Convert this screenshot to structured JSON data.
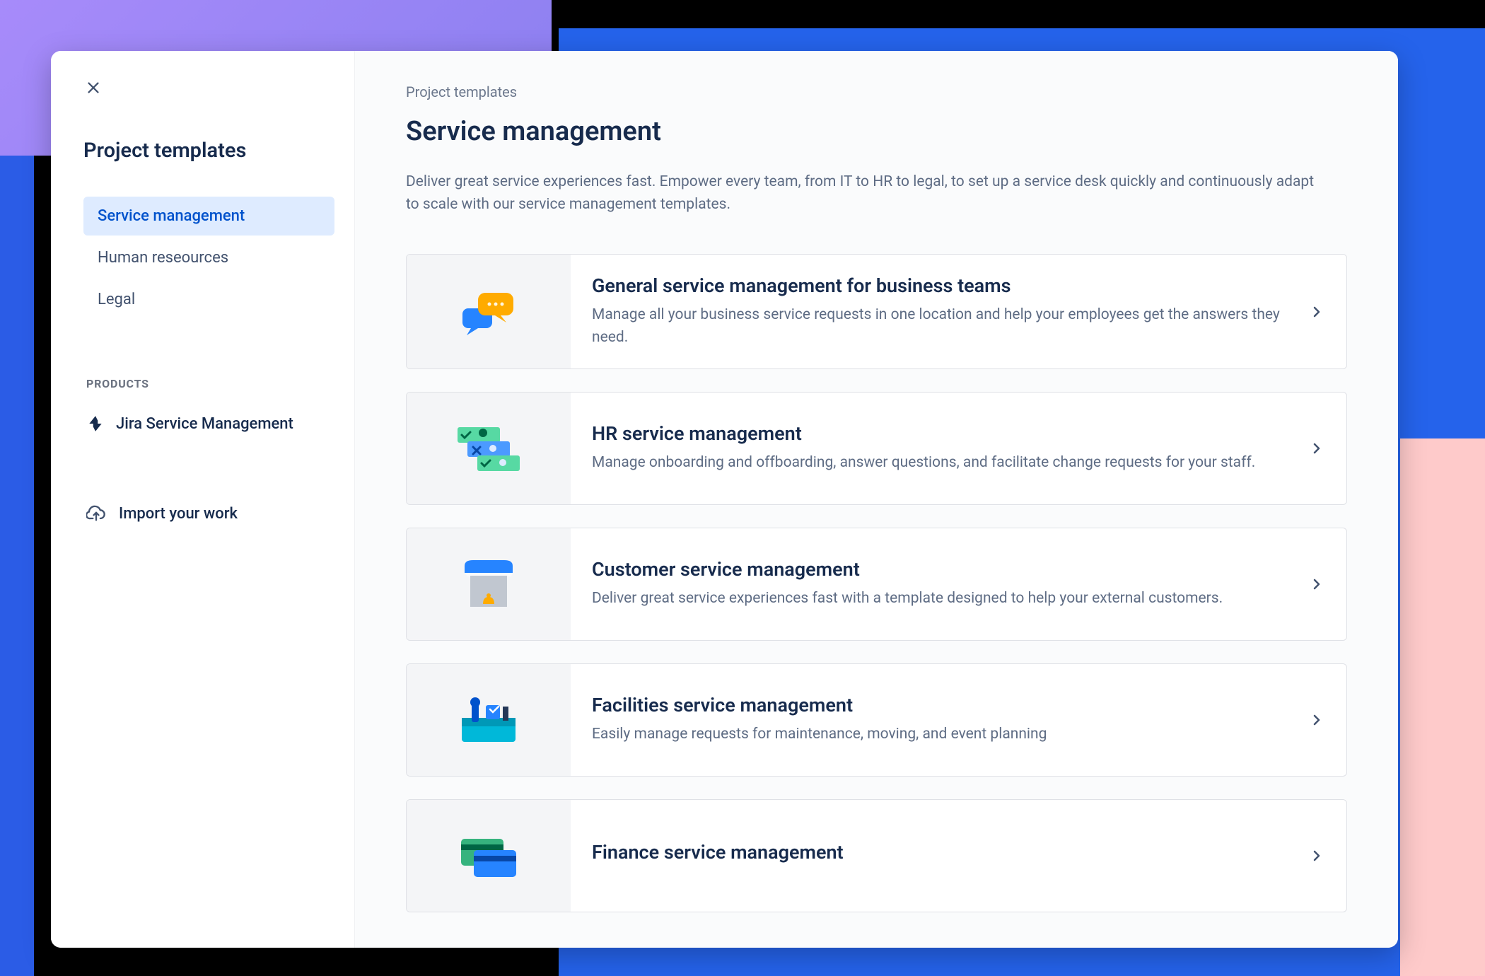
{
  "sidebar": {
    "title": "Project templates",
    "nav": [
      {
        "label": "Service management",
        "active": true
      },
      {
        "label": "Human reseources",
        "active": false
      },
      {
        "label": "Legal",
        "active": false
      }
    ],
    "products_label": "PRODUCTS",
    "products": [
      {
        "label": "Jira Service Management",
        "icon": "jira-icon"
      }
    ],
    "import_label": "Import your work"
  },
  "main": {
    "breadcrumb": "Project templates",
    "title": "Service management",
    "description": "Deliver great service experiences fast. Empower every team, from IT to HR to legal, to set up a service desk quickly and continuously adapt to scale with our service management templates.",
    "templates": [
      {
        "title": "General service management for business teams",
        "desc": "Manage all your business service requests in one location and help your employees get the answers they need.",
        "icon": "chat-icon"
      },
      {
        "title": "HR service management",
        "desc": "Manage onboarding and offboarding, answer questions, and facilitate change requests for your staff.",
        "icon": "hr-icon"
      },
      {
        "title": "Customer service management",
        "desc": "Deliver great service experiences fast with a template designed to help your external customers.",
        "icon": "storefront-icon"
      },
      {
        "title": "Facilities service management",
        "desc": "Easily manage requests for maintenance, moving, and event planning",
        "icon": "toolbox-icon"
      },
      {
        "title": "Finance service management",
        "desc": "",
        "icon": "finance-icon"
      }
    ]
  }
}
